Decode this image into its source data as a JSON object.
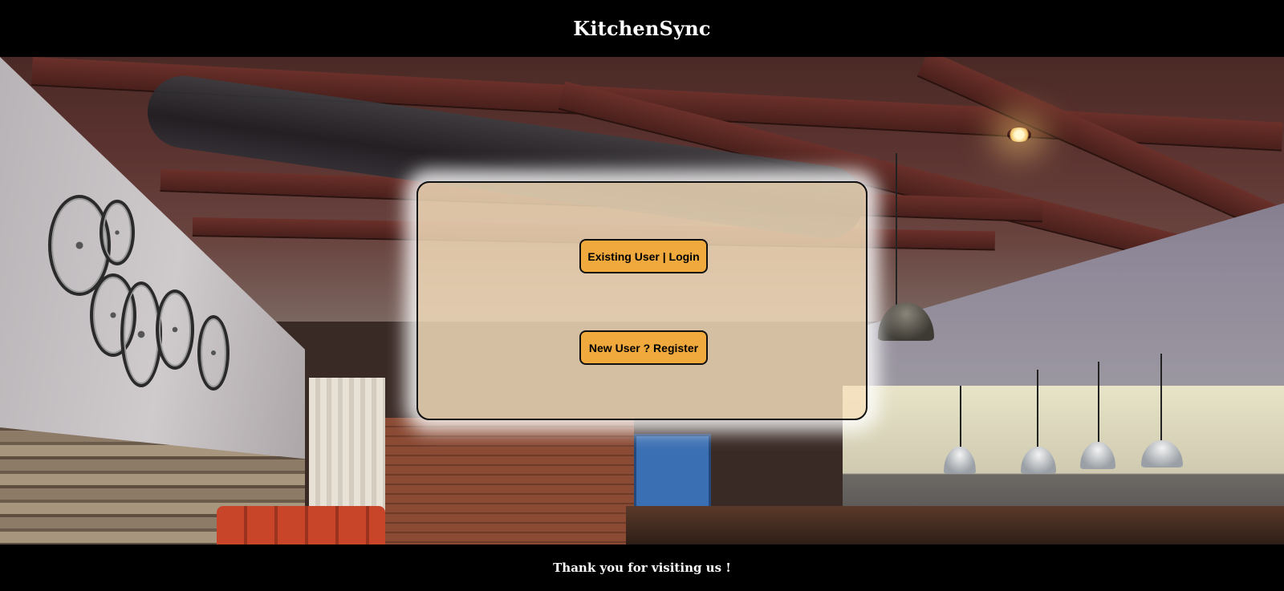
{
  "header": {
    "title": "KitchenSync"
  },
  "auth_panel": {
    "login_label": "Existing User | Login",
    "register_label": "New User ? Register"
  },
  "footer": {
    "text": "Thank you for visiting us !"
  },
  "colors": {
    "header_bg": "#000000",
    "panel_bg": "#f7e1be",
    "button_bg": "#f0a93d"
  }
}
